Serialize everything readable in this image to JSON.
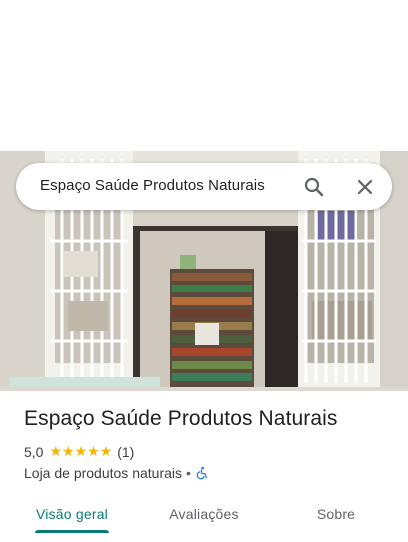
{
  "search": {
    "query": "Espaço Saúde Produtos Naturais"
  },
  "place": {
    "name": "Espaço Saúde Produtos Naturais",
    "rating": "5,0",
    "stars": "★★★★★",
    "review_count": "(1)",
    "category": "Loja de produtos naturais",
    "separator": "•"
  },
  "tabs": [
    {
      "label": "Visão geral",
      "active": true
    },
    {
      "label": "Avaliações",
      "active": false
    },
    {
      "label": "Sobre",
      "active": false
    }
  ],
  "icons": {
    "search": "search-icon",
    "close": "close-icon",
    "accessibility": "wheelchair-accessible-icon"
  },
  "colors": {
    "accent": "#0b7a75",
    "star": "#f4b400",
    "accessibility": "#1a73e8"
  }
}
